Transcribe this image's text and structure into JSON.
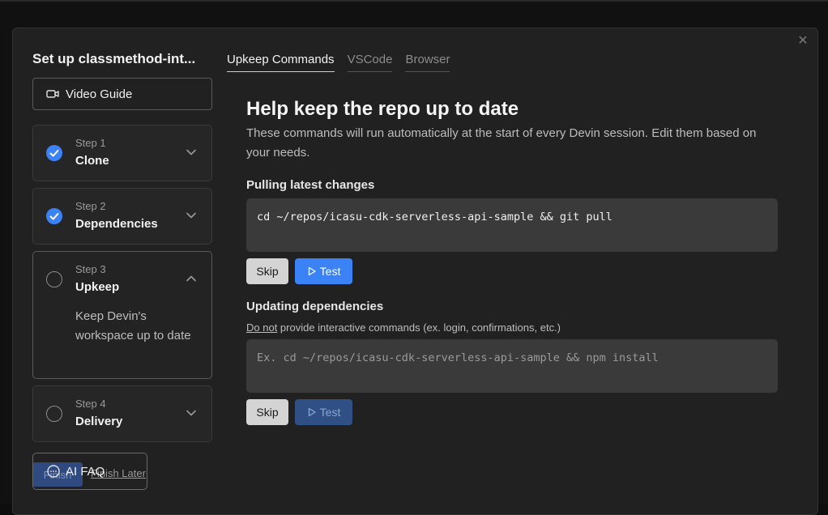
{
  "modal": {
    "title": "Set up classmethod-int...",
    "close_icon": "close-icon"
  },
  "sidebar": {
    "video_guide_label": "Video Guide",
    "steps": [
      {
        "step_label": "Step 1",
        "name": "Clone",
        "status": "done"
      },
      {
        "step_label": "Step 2",
        "name": "Dependencies",
        "status": "done"
      },
      {
        "step_label": "Step 3",
        "name": "Upkeep",
        "status": "current",
        "description": "Keep Devin's workspace up to date"
      },
      {
        "step_label": "Step 4",
        "name": "Delivery",
        "status": "todo"
      }
    ],
    "finish_label": "Finish",
    "finish_later_label": "Finish Later",
    "faq_label": "AI FAQ"
  },
  "tabs": [
    {
      "label": "Upkeep Commands",
      "active": true
    },
    {
      "label": "VSCode",
      "active": false
    },
    {
      "label": "Browser",
      "active": false
    }
  ],
  "main": {
    "title": "Help keep the repo up to date",
    "subtitle": "These commands will run automatically at the start of every Devin session. Edit them based on your needs.",
    "pull": {
      "label": "Pulling latest changes",
      "command": "cd ~/repos/icasu-cdk-serverless-api-sample && git pull",
      "skip_label": "Skip",
      "test_label": "Test"
    },
    "deps": {
      "label": "Updating dependencies",
      "note_emph": "Do not",
      "note_rest": " provide interactive commands (ex. login, confirmations, etc.)",
      "placeholder": "Ex. cd ~/repos/icasu-cdk-serverless-api-sample && npm install",
      "skip_label": "Skip",
      "test_label": "Test"
    }
  },
  "colors": {
    "accent": "#3b82f6",
    "background": "#212121"
  }
}
